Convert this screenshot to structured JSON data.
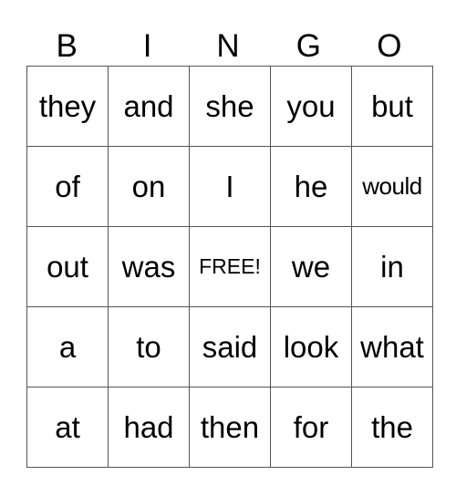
{
  "header": [
    "B",
    "I",
    "N",
    "G",
    "O"
  ],
  "grid": [
    [
      "they",
      "and",
      "she",
      "you",
      "but"
    ],
    [
      "of",
      "on",
      "I",
      "he",
      "would"
    ],
    [
      "out",
      "was",
      "FREE!",
      "we",
      "in"
    ],
    [
      "a",
      "to",
      "said",
      "look",
      "what"
    ],
    [
      "at",
      "had",
      "then",
      "for",
      "the"
    ]
  ]
}
